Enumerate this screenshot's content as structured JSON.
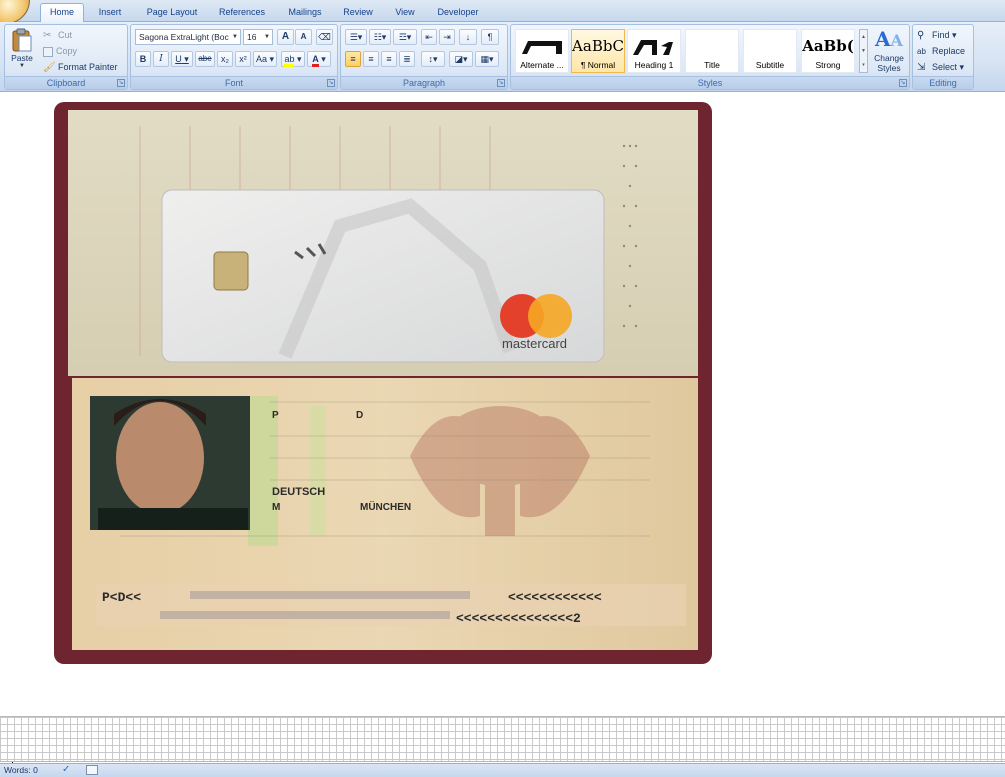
{
  "tabs": [
    {
      "label": "Home",
      "active": true
    },
    {
      "label": "Insert"
    },
    {
      "label": "Page Layout"
    },
    {
      "label": "References"
    },
    {
      "label": "Mailings"
    },
    {
      "label": "Review"
    },
    {
      "label": "View"
    },
    {
      "label": "Developer"
    }
  ],
  "clipboard": {
    "paste": "Paste",
    "cut": "Cut",
    "copy": "Copy",
    "format_painter": "Format Painter",
    "group_label": "Clipboard"
  },
  "font": {
    "name": "Sagona ExtraLight (Boc",
    "size": "16",
    "group_label": "Font",
    "bold": "B",
    "italic": "I",
    "underline": "U",
    "strike": "abe",
    "subscript": "x₂",
    "superscript": "x²",
    "change_case": "Aa",
    "grow": "A",
    "shrink": "A"
  },
  "paragraph": {
    "group_label": "Paragraph"
  },
  "styles": {
    "items": [
      {
        "preview": "",
        "name": "Alternate ..."
      },
      {
        "preview": "AaBbC",
        "name": "¶ Normal",
        "selected": true
      },
      {
        "preview": "",
        "name": "Heading 1"
      },
      {
        "preview": "",
        "name": "Title"
      },
      {
        "preview": "",
        "name": "Subtitle"
      },
      {
        "preview": "AaBb(",
        "name": "Strong"
      }
    ],
    "change_styles": "Change Styles",
    "group_label": "Styles"
  },
  "editing": {
    "find": "Find",
    "replace": "Replace",
    "select": "Select",
    "group_label": "Editing"
  },
  "passport": {
    "mrz_line1": "P<D<<",
    "mrz_line1_end": "<<<<<<<<<<<<",
    "mrz_line2_end": "<<<<<<<<<<<<<<<2",
    "type": "P",
    "code": "D",
    "nationality": "DEUTSCH",
    "sex": "M",
    "place_of_birth": "MÜNCHEN",
    "card_brand": "mastercard"
  },
  "status": {
    "words": "Words: 0"
  },
  "colors": {
    "ribbon_blue": "#15428b",
    "highlight": "#f0b94a"
  }
}
